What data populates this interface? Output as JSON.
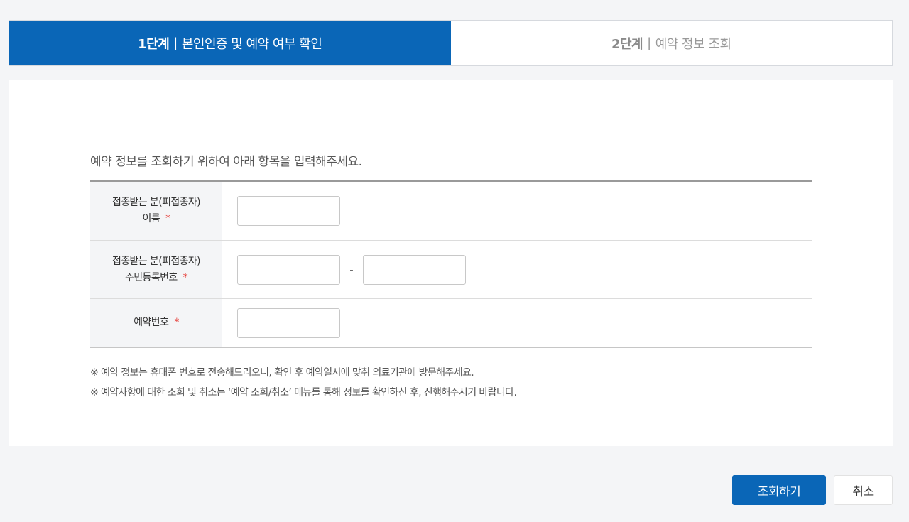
{
  "steps": [
    {
      "number": "1단계",
      "separator": "|",
      "label": "본인인증 및 예약 여부 확인",
      "active": true
    },
    {
      "number": "2단계",
      "separator": "|",
      "label": "예약 정보 조회",
      "active": false
    }
  ],
  "form": {
    "intro": "예약 정보를 조회하기 위하여 아래 항목을 입력해주세요.",
    "required_mark": "*",
    "name": {
      "label_line1": "접종받는 분(피접종자)",
      "label_line2": "이름",
      "value": ""
    },
    "rrn": {
      "label_line1": "접종받는 분(피접종자)",
      "label_line2": "주민등록번호",
      "front_value": "",
      "back_value": "",
      "separator": "-"
    },
    "reservation": {
      "label": "예약번호",
      "value": ""
    }
  },
  "notes": [
    "※ 예약 정보는 휴대폰 번호로 전송해드리오니, 확인 후 예약일시에 맞춰 의료기관에 방문해주세요.",
    "※ 예약사항에 대한 조회 및 취소는 ‘예약 조회/취소’ 메뉴를 통해 정보를 확인하신 후, 진행해주시기 바랍니다."
  ],
  "buttons": {
    "submit": "조회하기",
    "cancel": "취소"
  },
  "colors": {
    "primary": "#0a66b7",
    "required": "#e5322d",
    "background": "#f4f5f7"
  }
}
